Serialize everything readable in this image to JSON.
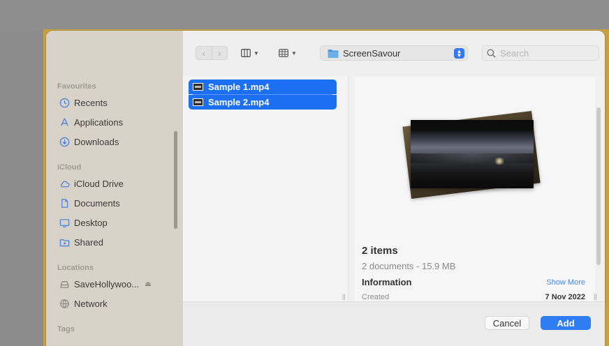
{
  "sidebar": {
    "sections": {
      "favourites": "Favourites",
      "icloud": "iCloud",
      "locations": "Locations",
      "tags": "Tags"
    },
    "favourites": [
      {
        "label": "Recents",
        "icon": "clock-icon"
      },
      {
        "label": "Applications",
        "icon": "applications-icon"
      },
      {
        "label": "Downloads",
        "icon": "download-icon"
      }
    ],
    "icloud": [
      {
        "label": "iCloud Drive",
        "icon": "cloud-icon"
      },
      {
        "label": "Documents",
        "icon": "document-icon"
      },
      {
        "label": "Desktop",
        "icon": "desktop-icon"
      },
      {
        "label": "Shared",
        "icon": "shared-folder-icon"
      }
    ],
    "locations": [
      {
        "label": "SaveHollywoo...",
        "icon": "drive-icon"
      },
      {
        "label": "Network",
        "icon": "globe-icon"
      }
    ]
  },
  "toolbar": {
    "path": "ScreenSavour",
    "search_placeholder": "Search"
  },
  "files": [
    {
      "name": "Sample 1.mp4"
    },
    {
      "name": "Sample 2.mp4"
    }
  ],
  "preview": {
    "count": "2 items",
    "summary": "2 documents - 15.9 MB",
    "info_heading": "Information",
    "show_more": "Show More",
    "created_label": "Created",
    "created_value": "7 Nov 2022"
  },
  "buttons": {
    "cancel": "Cancel",
    "add": "Add"
  },
  "colors": {
    "accent": "#1d6ff2",
    "add_button": "#2f7df4"
  }
}
